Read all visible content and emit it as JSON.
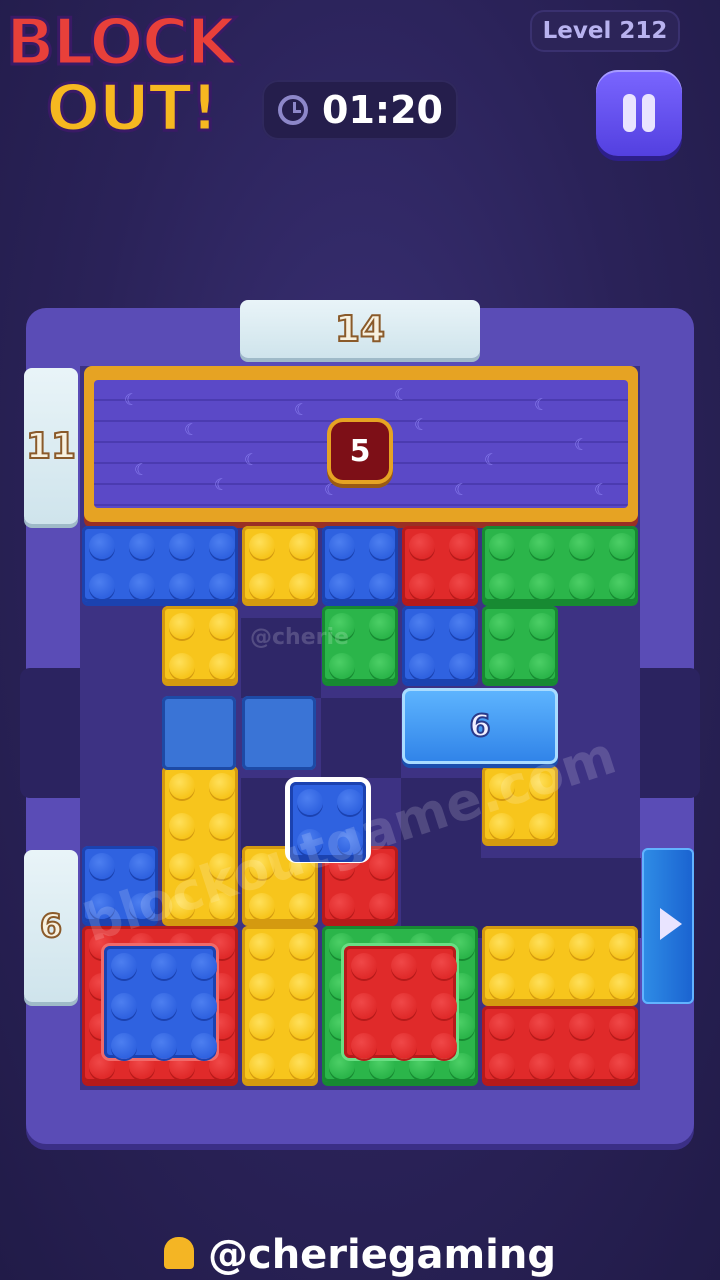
{
  "logo": {
    "line1": "BLOCK",
    "line2": "OUT!"
  },
  "header": {
    "level_label": "Level 212",
    "timer": "01:20"
  },
  "board": {
    "top_gate_count": "14",
    "left_top_gate_count": "11",
    "left_bottom_gate_count": "6",
    "featured_block_count": "5",
    "ice_block_count": "6"
  },
  "watermark": {
    "main": "blockoutgame.com",
    "small": "@cherie"
  },
  "footer": {
    "credit": "@cheriegaming"
  },
  "colors": {
    "red": "#e02a2a",
    "blue": "#2f62e0",
    "yellow": "#f7c51c",
    "green": "#2bb54a",
    "board": "#5a4cb6"
  },
  "icons": [
    "clock-icon",
    "pause-icon",
    "arrow-right-icon",
    "bell-icon",
    "moon-icon"
  ]
}
